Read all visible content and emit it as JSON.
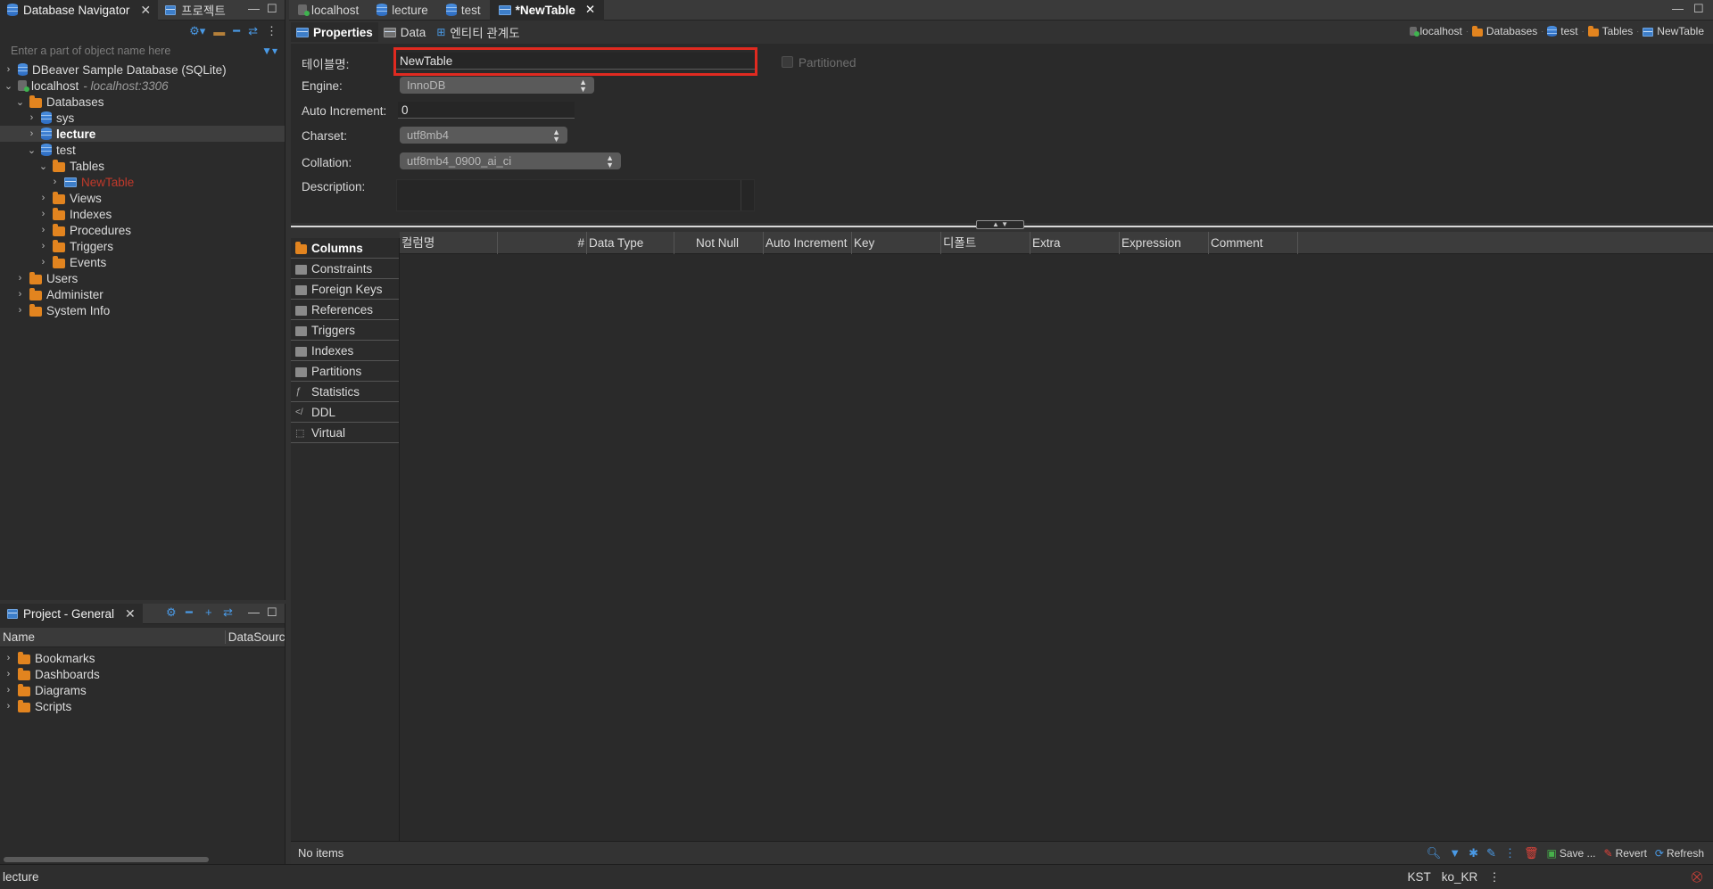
{
  "nav": {
    "tab_label": "Database Navigator",
    "tab2_label": "프로젝트",
    "filter_placeholder": "Enter a part of object name here",
    "tree": {
      "sample_db": "DBeaver Sample Database (SQLite)",
      "localhost": "localhost",
      "localhost_detail": "- localhost:3306",
      "databases": "Databases",
      "sys": "sys",
      "lecture": "lecture",
      "test": "test",
      "tables": "Tables",
      "new_table": "NewTable",
      "views": "Views",
      "indexes": "Indexes",
      "procedures": "Procedures",
      "triggers": "Triggers",
      "events": "Events",
      "users": "Users",
      "administer": "Administer",
      "system_info": "System Info"
    }
  },
  "project": {
    "tab_label": "Project - General",
    "col_name": "Name",
    "col_datasource": "DataSourc",
    "items": [
      "Bookmarks",
      "Dashboards",
      "Diagrams",
      "Scripts"
    ]
  },
  "editor": {
    "tabs": [
      "localhost",
      "lecture",
      "test",
      "*NewTable"
    ],
    "subtabs": [
      "Properties",
      "Data",
      "엔티티 관계도"
    ],
    "breadcrumbs": [
      "localhost",
      "Databases",
      "test",
      "Tables",
      "NewTable"
    ]
  },
  "properties": {
    "table_name_label": "테이블명:",
    "table_name_value": "NewTable",
    "partitioned_label": "Partitioned",
    "engine_label": "Engine:",
    "engine_value": "InnoDB",
    "auto_inc_label": "Auto Increment:",
    "auto_inc_value": "0",
    "charset_label": "Charset:",
    "charset_value": "utf8mb4",
    "collation_label": "Collation:",
    "collation_value": "utf8mb4_0900_ai_ci",
    "description_label": "Description:"
  },
  "side_tabs": [
    "Columns",
    "Constraints",
    "Foreign Keys",
    "References",
    "Triggers",
    "Indexes",
    "Partitions",
    "Statistics",
    "DDL",
    "Virtual"
  ],
  "grid_columns": [
    "컬럼명",
    "#",
    "Data Type",
    "Not Null",
    "Auto Increment",
    "Key",
    "디폴트",
    "Extra",
    "Expression",
    "Comment"
  ],
  "bottom": {
    "status": "No items",
    "save_label": "Save ...",
    "revert_label": "Revert",
    "refresh_label": "Refresh"
  },
  "statusbar": {
    "left": "lecture",
    "timezone": "KST",
    "locale": "ko_KR"
  },
  "colors": {
    "highlight_box": "#e02a20",
    "accent_blue": "#4a9ae6",
    "folder_orange": "#e2841f"
  }
}
